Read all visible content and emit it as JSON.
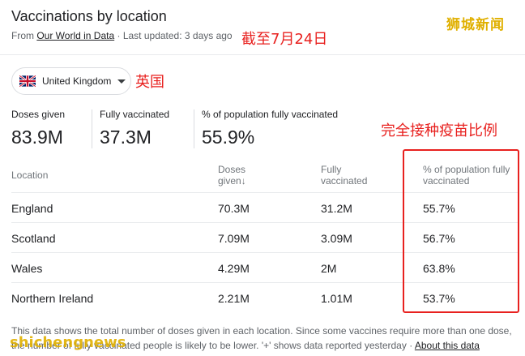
{
  "header": {
    "title": "Vaccinations by location",
    "source_prefix": "From",
    "source_link": "Our World in Data",
    "updated": "· Last updated: 3 days ago"
  },
  "annotations": {
    "brand": "狮城新闻",
    "as_of": "截至7月24日",
    "uk_label": "英国",
    "pct_label": "完全接种疫苗比例",
    "watermark": "shichengnews"
  },
  "location_select": {
    "flag_icon": "uk-flag-icon",
    "selected": "United Kingdom"
  },
  "stats": [
    {
      "label": "Doses given",
      "value": "83.9M"
    },
    {
      "label": "Fully vaccinated",
      "value": "37.3M"
    },
    {
      "label": "% of population fully vaccinated",
      "value": "55.9%"
    }
  ],
  "table": {
    "headers": {
      "location": "Location",
      "doses_l1": "Doses",
      "doses_l2": "given",
      "fully_l1": "Fully",
      "fully_l2": "vaccinated",
      "pct_l1": "% of population fully",
      "pct_l2": "vaccinated"
    },
    "rows": [
      {
        "location": "England",
        "doses": "70.3M",
        "fully": "31.2M",
        "pct": "55.7%"
      },
      {
        "location": "Scotland",
        "doses": "7.09M",
        "fully": "3.09M",
        "pct": "56.7%"
      },
      {
        "location": "Wales",
        "doses": "4.29M",
        "fully": "2M",
        "pct": "63.8%"
      },
      {
        "location": "Northern Ireland",
        "doses": "2.21M",
        "fully": "1.01M",
        "pct": "53.7%"
      }
    ]
  },
  "footnote": {
    "text1": "This data shows the total number of doses given in each location. Since some vaccines require more than one dose,",
    "text2": "the number of fully vaccinated people is likely to be lower. '+' shows data reported yesterday",
    "separator": "·",
    "about_link": "About this data"
  },
  "colors": {
    "annotation_red": "#e8211f",
    "brand_gold": "#e0b000",
    "text_primary": "#202124",
    "text_secondary": "#5f6368"
  }
}
